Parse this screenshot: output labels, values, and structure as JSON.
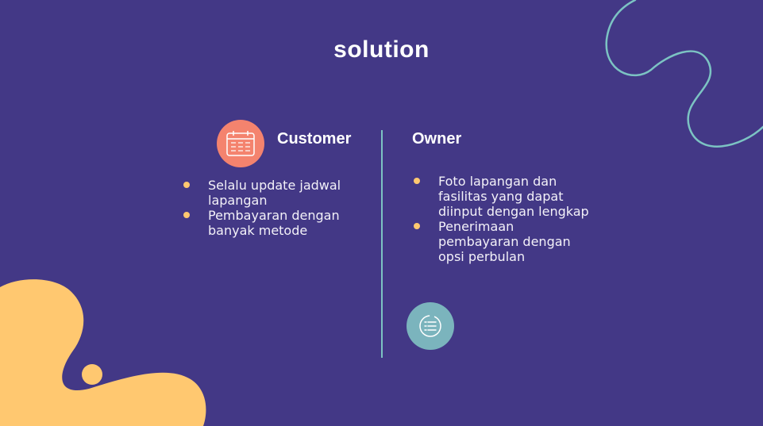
{
  "title": "solution",
  "customer": {
    "heading": "Customer",
    "items": [
      "Selalu update jadwal lapangan",
      "Pembayaran dengan banyak metode"
    ]
  },
  "owner": {
    "heading": "Owner",
    "items": [
      "Foto lapangan dan fasilitas yang dapat diinput dengan lengkap",
      "Penerimaan pembayaran dengan opsi perbulan"
    ]
  },
  "colors": {
    "background": "#433886",
    "blob": "#ffc870",
    "squiggle": "#7cc3c3",
    "customer_icon_bg": "#f4836e",
    "owner_icon_bg": "#7bb4bd",
    "bullet": "#ffc870"
  },
  "icons": {
    "customer": "calendar-icon",
    "owner": "checklist-icon"
  }
}
